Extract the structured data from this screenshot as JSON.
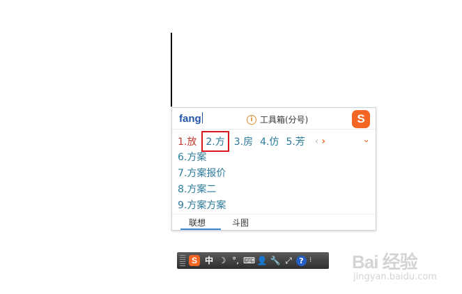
{
  "ime": {
    "input": "fang",
    "toolbox_label": "工具箱(分号)",
    "logo_letter": "S",
    "candidates": [
      "1.放",
      "2.方",
      "3.房",
      "4.仿",
      "5.芳"
    ],
    "phrases": [
      "6.方案",
      "7.方案报价",
      "8.方案二",
      "9.方案方案"
    ],
    "nav_prev": "‹",
    "nav_next": "›",
    "expand": "⌄",
    "tabs": [
      "联想",
      "斗图"
    ]
  },
  "statusbar": {
    "logo_letter": "S",
    "mode": "中",
    "items": [
      "☽",
      "°,",
      "⌨",
      "👤",
      "🔧",
      "⤢"
    ],
    "help": "?",
    "menu": "⁝"
  },
  "watermark": {
    "main": "Bai 经验",
    "sub": "jingyan.baidu.com"
  },
  "colors": {
    "candidate_text": "#2a7a9a",
    "active_candidate": "#c0392b",
    "highlight_box": "#d9161c",
    "sogou_orange": "#f26522"
  }
}
